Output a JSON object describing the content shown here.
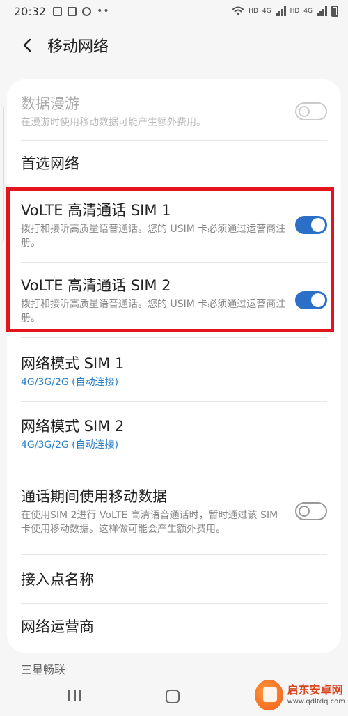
{
  "status_bar": {
    "time": "20:32",
    "hd1": "HD",
    "net1": "4G",
    "hd2": "HD",
    "net2": "4G"
  },
  "header": {
    "title": "移动网络"
  },
  "settings": {
    "data_roaming": {
      "title": "数据漫游",
      "desc": "在漫游时使用移动数据可能产生额外费用。",
      "enabled": false,
      "disabled": true
    },
    "preferred_network": {
      "title": "首选网络"
    },
    "volte_sim1": {
      "title": "VoLTE 高清通话 SIM 1",
      "desc": "拨打和接听高质量语音通话。您的 USIM 卡必须通过运营商注册。",
      "enabled": true
    },
    "volte_sim2": {
      "title": "VoLTE 高清通话 SIM 2",
      "desc": "拨打和接听高质量语音通话。您的 USIM 卡必须通过运营商注册。",
      "enabled": true
    },
    "network_mode_sim1": {
      "title": "网络模式 SIM 1",
      "value": "4G/3G/2G (自动连接)"
    },
    "network_mode_sim2": {
      "title": "网络模式 SIM 2",
      "value": "4G/3G/2G (自动连接)"
    },
    "data_during_calls": {
      "title": "通话期间使用移动数据",
      "desc": "在使用SIM 2进行 VoLTE 高清语音通话时，暂时通过该 SIM 卡使用移动数据。这样做可能会产生额外费用。",
      "enabled": false
    },
    "apn": {
      "title": "接入点名称"
    },
    "network_operators": {
      "title": "网络运营商"
    }
  },
  "section_label": "三星畅联",
  "watermark": {
    "name": "启东安卓网",
    "url": "www.qdltdq.com"
  },
  "colors": {
    "accent": "#2c6fc9",
    "highlight": "#e3141b",
    "link": "#2a7fc9"
  },
  "icons": {
    "back": "back-arrow-icon",
    "recents": "recents-icon",
    "home": "home-icon"
  }
}
